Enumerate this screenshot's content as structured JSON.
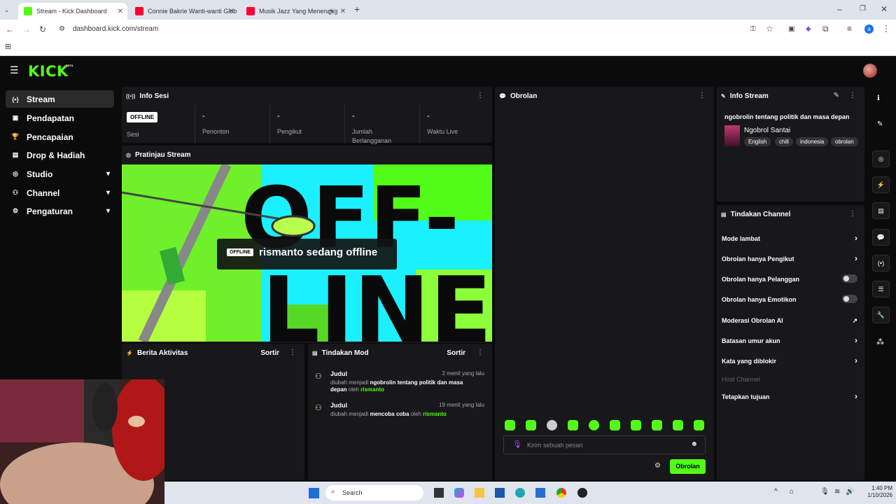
{
  "browser": {
    "tabs": [
      {
        "label": "Stream - Kick Dashboard",
        "favicon_color": "#53fc18"
      },
      {
        "label": "Connie Bakrie Wanti-wanti Glob",
        "favicon_color": "#ff0033"
      },
      {
        "label": "Musik Jazz Yang Menenang",
        "favicon_color": "#ff0033"
      }
    ],
    "new_tab": "+",
    "url": "dashboard.kick.com/stream"
  },
  "header": {
    "logo": "KICK",
    "beta": "BETA"
  },
  "sidebar": {
    "items": [
      {
        "label": "Stream",
        "icon": "radio-waves-icon",
        "expandable": false
      },
      {
        "label": "Pendapatan",
        "icon": "wallet-icon",
        "expandable": false
      },
      {
        "label": "Pencapaian",
        "icon": "trophy-icon",
        "expandable": false
      },
      {
        "label": "Drop & Hadiah",
        "icon": "gift-icon",
        "expandable": false
      },
      {
        "label": "Studio",
        "icon": "studio-icon",
        "expandable": true
      },
      {
        "label": "Channel",
        "icon": "channel-icon",
        "expandable": true
      },
      {
        "label": "Pengaturan",
        "icon": "gear-icon",
        "expandable": true
      }
    ]
  },
  "info_sesi": {
    "title": "Info Sesi",
    "badge": "OFFLINE",
    "stats": [
      {
        "value": "",
        "label": "Sesi"
      },
      {
        "value": "-",
        "label": "Penonton"
      },
      {
        "value": "-",
        "label": "Pengikut"
      },
      {
        "value": "-",
        "label": "Jumlah Berlangganan"
      },
      {
        "value": "-",
        "label": "Waktu Live"
      }
    ]
  },
  "preview": {
    "title": "Pratinjau Stream",
    "badge": "OFFLINE",
    "message": "rismanto sedang offline",
    "bg_text_1": "OFF-",
    "bg_text_2": "LINE"
  },
  "berita": {
    "title": "Berita Aktivitas",
    "sort": "Sortir"
  },
  "mod": {
    "title": "Tindakan Mod",
    "sort": "Sortir",
    "entries": [
      {
        "title": "Judul",
        "time": "2 menit yang lalu",
        "prefix": "diubah menjadi ",
        "value": "ngobrolin tentang politik dan masa depan",
        "by": " oleh ",
        "user": "rismanto"
      },
      {
        "title": "Judul",
        "time": "19 menit yang lalu",
        "prefix": "diubah menjadi ",
        "value": "mencoba coba",
        "by": " oleh ",
        "user": "rismanto"
      }
    ]
  },
  "chat": {
    "title": "Obrolan",
    "placeholder": "Kirim sebuah pesan",
    "send": "Obrolan"
  },
  "info_stream": {
    "title": "Info Stream",
    "stream_title": "ngobrolin tentang politik dan masa depan",
    "category": "Ngobrol Santai",
    "tags": [
      "English",
      "chill",
      "indonesia",
      "obrolan"
    ]
  },
  "channel_actions": {
    "title": "Tindakan Channel",
    "items": [
      {
        "label": "Mode lambat",
        "control": "arrow"
      },
      {
        "label": "Obrolan hanya Pengikut",
        "control": "arrow"
      },
      {
        "label": "Obrolan hanya Pelanggan",
        "control": "toggle"
      },
      {
        "label": "Obrolan hanya Emotikon",
        "control": "toggle"
      },
      {
        "label": "Moderasi Obrolan AI",
        "control": "external"
      },
      {
        "label": "Batasan umur akun",
        "control": "arrow"
      },
      {
        "label": "Kata yang diblokir",
        "control": "arrow"
      },
      {
        "label": "Host Channel",
        "control": "disabled"
      },
      {
        "label": "Tetapkan tujuan",
        "control": "arrow"
      }
    ]
  },
  "taskbar": {
    "search": "Search",
    "time": "1:40 PM",
    "date": "1/10/2026"
  },
  "colors": {
    "accent": "#53fc18",
    "panel": "#18181b",
    "bg": "#0b0b0b"
  }
}
